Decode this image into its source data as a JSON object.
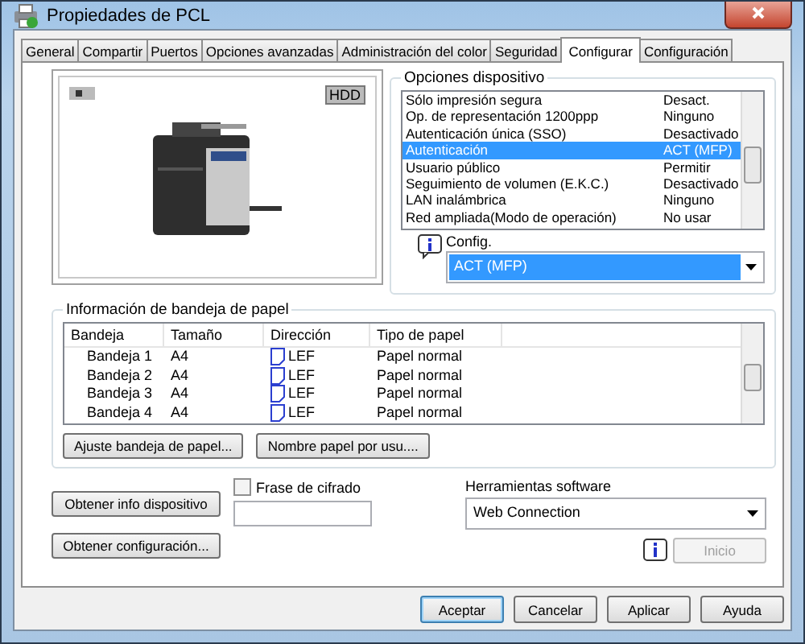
{
  "window": {
    "title": "Propiedades de PCL"
  },
  "tabs": [
    {
      "label": "General",
      "selected": false
    },
    {
      "label": "Compartir",
      "selected": false
    },
    {
      "label": "Puertos",
      "selected": false
    },
    {
      "label": "Opciones avanzadas",
      "selected": false
    },
    {
      "label": "Administración del color",
      "selected": false
    },
    {
      "label": "Seguridad",
      "selected": false
    },
    {
      "label": "Configurar",
      "selected": true
    },
    {
      "label": "Configuración",
      "selected": false
    }
  ],
  "device_preview": {
    "badge": "HDD"
  },
  "device_options": {
    "title": "Opciones dispositivo",
    "items": [
      {
        "name": "Sólo impresión segura",
        "value": "Desact.",
        "selected": false
      },
      {
        "name": "Op. de representación 1200ppp",
        "value": "Ninguno",
        "selected": false
      },
      {
        "name": "Autenticación única (SSO)",
        "value": "Desactivado",
        "selected": false
      },
      {
        "name": "Autenticación",
        "value": "ACT (MFP)",
        "selected": true
      },
      {
        "name": "Usuario público",
        "value": "Permitir",
        "selected": false
      },
      {
        "name": "Seguimiento de volumen (E.K.C.)",
        "value": "Desactivado",
        "selected": false
      },
      {
        "name": "LAN inalámbrica",
        "value": "Ninguno",
        "selected": false
      },
      {
        "name": "Red ampliada(Modo de operación)",
        "value": "No usar",
        "selected": false
      }
    ],
    "config_label": "Config.",
    "config_value": "ACT (MFP)"
  },
  "paper_tray_info": {
    "title": "Información de bandeja de papel",
    "columns": [
      "Bandeja",
      "Tamaño",
      "Dirección",
      "Tipo de papel"
    ],
    "rows": [
      {
        "tray": "Bandeja 1",
        "size": "A4",
        "direction": "LEF",
        "type": "Papel normal"
      },
      {
        "tray": "Bandeja 2",
        "size": "A4",
        "direction": "LEF",
        "type": "Papel normal"
      },
      {
        "tray": "Bandeja 3",
        "size": "A4",
        "direction": "LEF",
        "type": "Papel normal"
      },
      {
        "tray": "Bandeja 4",
        "size": "A4",
        "direction": "LEF",
        "type": "Papel normal"
      }
    ],
    "buttons": [
      "Ajuste bandeja de papel...",
      "Nombre papel por usu...."
    ]
  },
  "get_device_info_button": "Obtener info dispositivo",
  "passphrase": {
    "label": "Frase de cifrado",
    "checked": false
  },
  "get_config_button": "Obtener configuración...",
  "software_tools": {
    "label": "Herramientas software",
    "value": "Web Connection"
  },
  "start_button": {
    "label": "Inicio",
    "disabled": true
  },
  "dialog_buttons": [
    {
      "label": "Aceptar",
      "default": true
    },
    {
      "label": "Cancelar",
      "default": false
    },
    {
      "label": "Aplicar",
      "default": false
    },
    {
      "label": "Ayuda",
      "default": false
    }
  ]
}
